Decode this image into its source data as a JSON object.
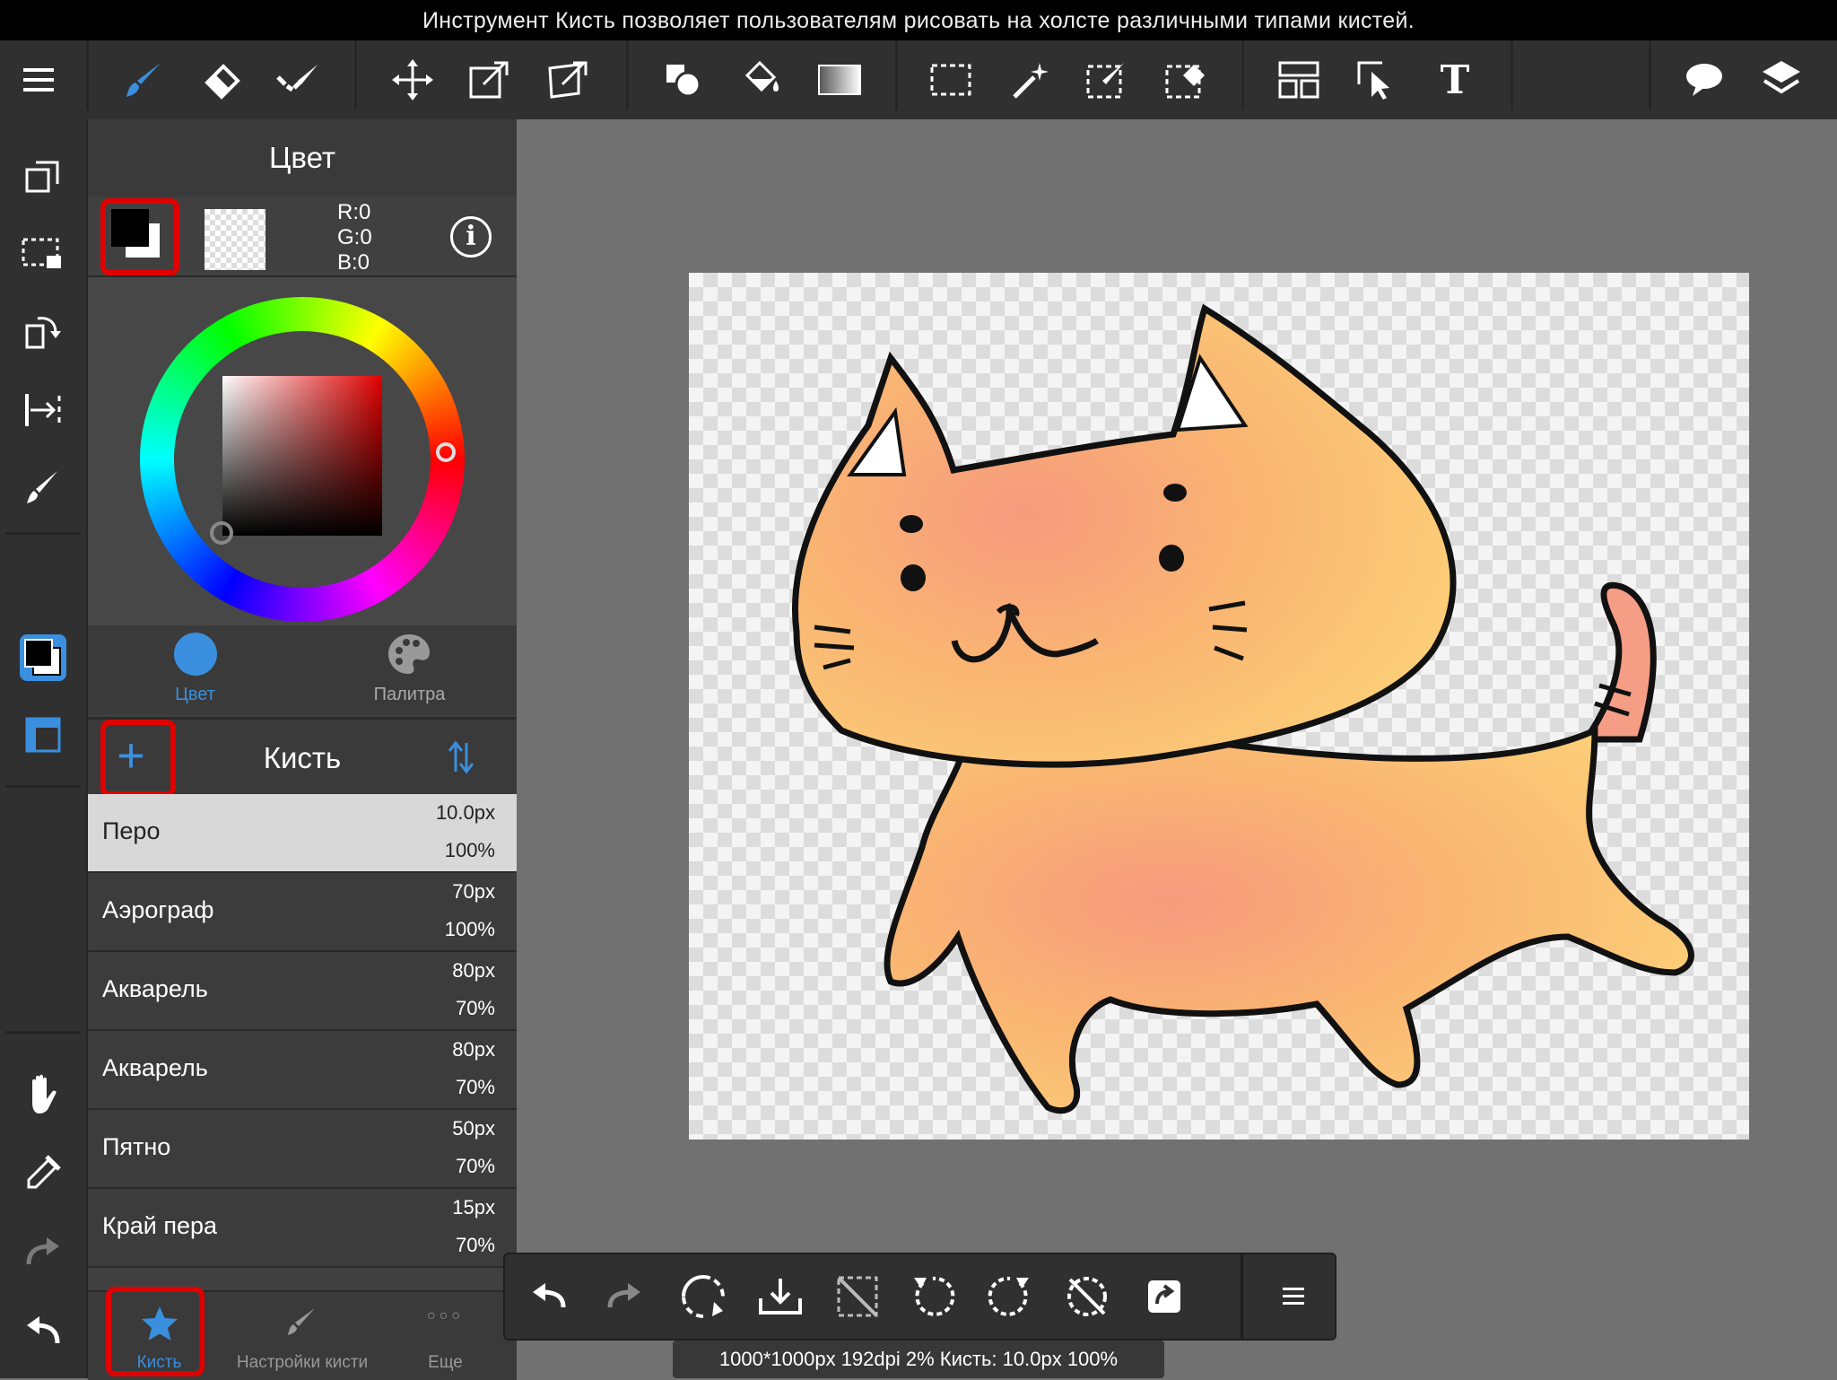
{
  "banner": {
    "text": "Инструмент Кисть позволяет пользователям рисовать на холсте различными типами кистей."
  },
  "colors": {
    "accent": "#3a8fde",
    "highlight_red": "#e00000",
    "toolbar_bg": "#303030",
    "panel_bg": "#404040",
    "canvas_bg": "#717171"
  },
  "toolbar": {
    "left_icons": [
      "menu-icon"
    ],
    "draw_tools": [
      "brush-icon",
      "eraser-icon",
      "dotted-brush-icon"
    ],
    "transform_tools": [
      "move-icon",
      "transform-icon",
      "mesh-transform-icon"
    ],
    "fill_tools": [
      "shape-icon",
      "bucket-icon",
      "gradient-icon"
    ],
    "select_tools": [
      "select-rect-icon",
      "magic-wand-icon",
      "select-pen-icon",
      "select-eraser-icon"
    ],
    "other_tools": [
      "frame-divider-icon",
      "operation-icon",
      "text-icon"
    ],
    "right_icons": [
      "speech-bubble-icon",
      "layers-icon"
    ],
    "text_tool_glyph": "T"
  },
  "leftstrip": {
    "icons": [
      "copy-icon",
      "selection-icon",
      "rotate-icon",
      "ruler-icon",
      "brush-pen-icon",
      "color-swatch-icon",
      "layer-toggle-icon",
      "hand-icon",
      "eyedropper-icon",
      "redo-icon",
      "undo-icon"
    ]
  },
  "color_panel": {
    "title": "Цвет",
    "r": "R:0",
    "g": "G:0",
    "b": "B:0",
    "info_glyph": "i",
    "tabs": [
      {
        "label": "Цвет",
        "active": true
      },
      {
        "label": "Палитра",
        "active": false
      }
    ]
  },
  "brush_panel": {
    "title": "Кисть",
    "add_glyph": "+",
    "brushes": [
      {
        "name": "Перо",
        "size": "10.0px",
        "opacity": "100%",
        "selected": true
      },
      {
        "name": "Аэрограф",
        "size": "70px",
        "opacity": "100%",
        "selected": false
      },
      {
        "name": "Акварель",
        "size": "80px",
        "opacity": "70%",
        "selected": false
      },
      {
        "name": "Акварель",
        "size": "80px",
        "opacity": "70%",
        "selected": false
      },
      {
        "name": "Пятно",
        "size": "50px",
        "opacity": "70%",
        "selected": false
      },
      {
        "name": "Край пера",
        "size": "15px",
        "opacity": "70%",
        "selected": false
      }
    ],
    "bottom_tabs": [
      {
        "label": "Кисть",
        "icon": "star-icon",
        "active": true
      },
      {
        "label": "Настройки кисти",
        "icon": "brush-settings-icon",
        "active": false
      },
      {
        "label": "Еще",
        "icon": "more-icon",
        "active": false,
        "glyph": "○○○"
      }
    ]
  },
  "bottombar": {
    "icons": [
      "undo-icon",
      "redo-icon",
      "transform-rotate-icon",
      "save-icon",
      "deselect-icon",
      "rotate-left-icon",
      "rotate-right-icon",
      "reset-rotation-icon",
      "export-icon",
      "hamburger-icon"
    ]
  },
  "status": {
    "text": "1000*1000px 192dpi 2% Кисть: 10.0px 100%"
  }
}
